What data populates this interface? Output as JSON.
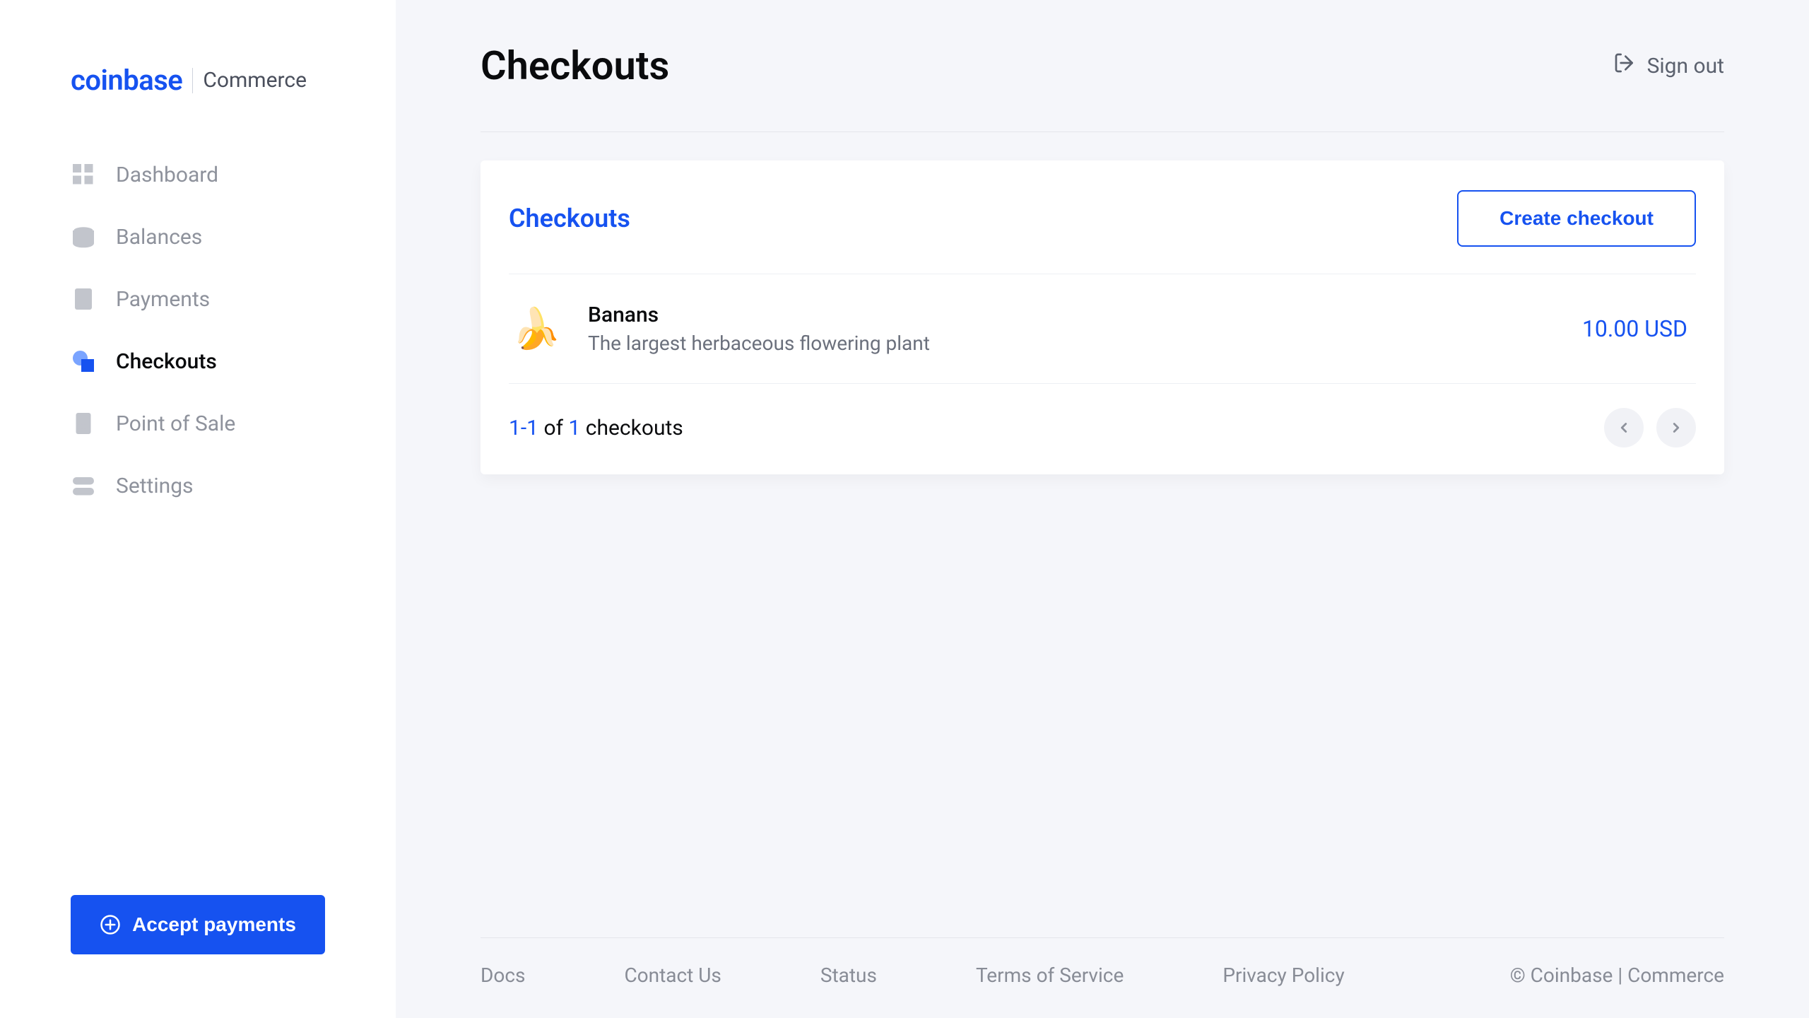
{
  "brand": {
    "main": "coinbase",
    "sub": "Commerce"
  },
  "sidebar": {
    "items": [
      {
        "label": "Dashboard"
      },
      {
        "label": "Balances"
      },
      {
        "label": "Payments"
      },
      {
        "label": "Checkouts"
      },
      {
        "label": "Point of Sale"
      },
      {
        "label": "Settings"
      }
    ],
    "accept_label": "Accept payments"
  },
  "header": {
    "title": "Checkouts",
    "signout": "Sign out"
  },
  "card": {
    "title": "Checkouts",
    "create_label": "Create checkout",
    "items": [
      {
        "name": "Banans",
        "desc": "The largest herbaceous flowering plant",
        "price": "10.00 USD",
        "emoji": "🍌"
      }
    ],
    "counter": {
      "range": "1-1",
      "of": "of",
      "total": "1",
      "suffix": "checkouts"
    }
  },
  "footer": {
    "links": [
      "Docs",
      "Contact Us",
      "Status",
      "Terms of Service",
      "Privacy Policy"
    ],
    "copyright": "© Coinbase | Commerce"
  }
}
